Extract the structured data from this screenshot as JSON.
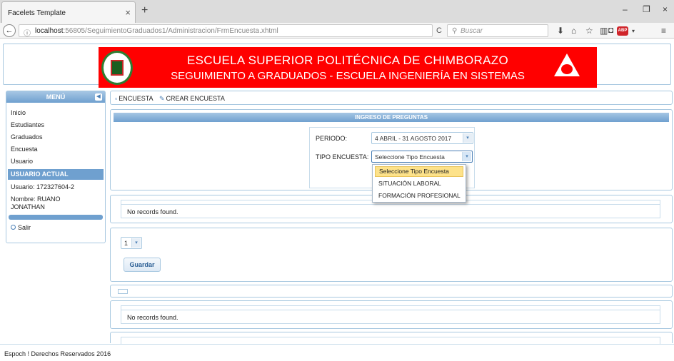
{
  "browser": {
    "tab_title": "Facelets Template",
    "tab_close": "×",
    "new_tab": "+",
    "url_host": "localhost",
    "url_path": ":56805/SeguimientoGraduados1/Administracion/FrmEncuesta.xhtml",
    "search_placeholder": "Buscar",
    "abp_label": "ABP",
    "win_minimize": "–",
    "win_restore": "❐",
    "win_close": "×"
  },
  "banner": {
    "line1": "ESCUELA SUPERIOR POLITÉCNICA DE CHIMBORAZO",
    "line2": "SEGUIMIENTO A GRADUADOS - ESCUELA INGENIERÍA EN SISTEMAS",
    "bg_color": "#ff0000"
  },
  "sidebar": {
    "title": "MENÚ",
    "items": [
      {
        "label": "Inicio"
      },
      {
        "label": "Estudiantes"
      },
      {
        "label": "Graduados"
      },
      {
        "label": "Encuesta"
      },
      {
        "label": "Usuario"
      }
    ],
    "current_user_header": "USUARIO ACTUAL",
    "user_line": "Usuario: 172327604-2",
    "name_line1": "Nombre: RUANO",
    "name_line2": "JONATHAN",
    "exit_label": "Salir"
  },
  "toolbar": {
    "encuesta_label": "ENCUESTA",
    "crear_label": "CREAR ENCUESTA"
  },
  "form": {
    "section_title": "INGRESO DE PREGUNTAS",
    "periodo_label": "PERIODO:",
    "periodo_value": "4 ABRIL - 31 AGOSTO 2017",
    "tipo_label": "TIPO ENCUESTA:",
    "tipo_value": "Seleccione Tipo Encuesta"
  },
  "dropdown": {
    "options": [
      {
        "label": "Seleccione Tipo Encuesta"
      },
      {
        "label": "SITUACIÓN LABORAL"
      },
      {
        "label": "FORMACIÓN PROFESIONAL"
      }
    ],
    "highlight_color": "#fde28a"
  },
  "table1": {
    "empty_message": "No records found."
  },
  "pager": {
    "value": "1"
  },
  "actions": {
    "save_label": "Guardar"
  },
  "table2": {
    "empty_message": "No records found."
  },
  "footer": {
    "text": "Espoch ! Derechos Reservados 2016"
  },
  "colors": {
    "accent": "#6fa0cf",
    "border": "#a8c8e0"
  }
}
